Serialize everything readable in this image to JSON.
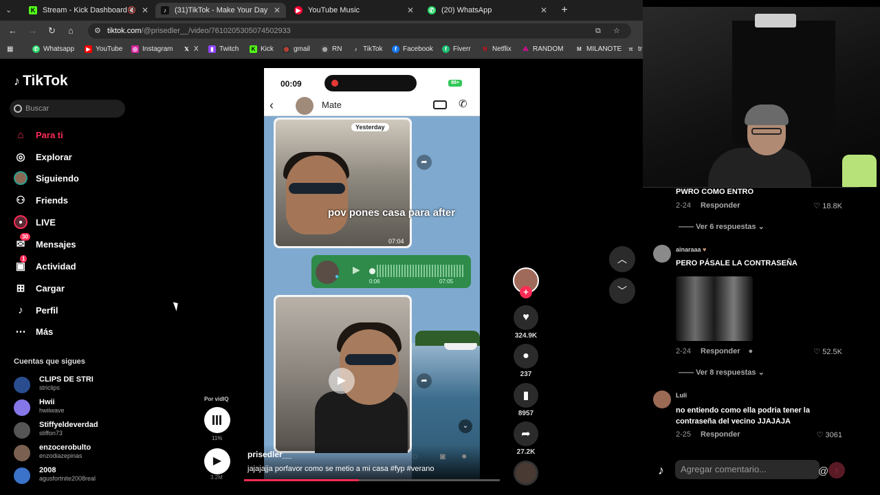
{
  "tabs": [
    {
      "label": "Stream - Kick Dashboard",
      "icon": "kick-icon",
      "color": "#53fc18"
    },
    {
      "label": "(31)TikTok - Make Your Day",
      "icon": "tiktok-icon",
      "color": "#ffffff"
    },
    {
      "label": "YouTube Music",
      "icon": "youtube-music-icon",
      "color": "#ff0033"
    },
    {
      "label": "(20) WhatsApp",
      "icon": "whatsapp-icon",
      "color": "#25d366"
    }
  ],
  "address": {
    "host": "tiktok.com",
    "path": "/@prisedler__/video/7610205305074502933"
  },
  "bookmarks": [
    "Whatsapp",
    "YouTube",
    "Instagram",
    "X",
    "Twitch",
    "Kick",
    "gmail",
    "RN",
    "TikTok",
    "Facebook",
    "Fiverr",
    "Netflix",
    "RANDOM",
    "MILANOTE",
    "tr"
  ],
  "sidebar": {
    "logo": "TikTok",
    "search_placeholder": "Buscar",
    "nav": [
      {
        "label": "Para ti",
        "icon": "home-icon"
      },
      {
        "label": "Explorar",
        "icon": "compass-icon"
      },
      {
        "label": "Siguiendo",
        "icon": "following-avatar-icon"
      },
      {
        "label": "Friends",
        "icon": "friends-icon"
      },
      {
        "label": "LIVE",
        "icon": "live-icon"
      },
      {
        "label": "Mensajes",
        "icon": "messages-icon",
        "badge": "30"
      },
      {
        "label": "Actividad",
        "icon": "activity-icon",
        "badge": "1"
      },
      {
        "label": "Cargar",
        "icon": "upload-icon"
      },
      {
        "label": "Perfil",
        "icon": "profile-icon"
      },
      {
        "label": "Más",
        "icon": "more-icon"
      }
    ],
    "following_title": "Cuentas que sigues",
    "accounts": [
      {
        "name": "CLIPS DE STRI",
        "handle": "striclips"
      },
      {
        "name": "Hwii",
        "handle": "hwiiwave"
      },
      {
        "name": "Stiffyeldeverdad",
        "handle": "stiffon73"
      },
      {
        "name": "enzocerobulto",
        "handle": "enzodiazepinas"
      },
      {
        "name": "2008",
        "handle": "agusfortnite2008real"
      }
    ]
  },
  "video": {
    "phone_time": "00:09",
    "battery": "88+",
    "contact": "Mate",
    "yesterday_label": "Yesterday",
    "overlay_text": "pov pones casa para after",
    "msg1_time": "07:04",
    "voice_duration": "0:06",
    "voice_time": "07:05",
    "author": "prisedler__",
    "caption": "jajajajja porfavor como se metio a mi casa #fyp #verano",
    "progress": 0.45
  },
  "music": {
    "label": "Por vidIQ",
    "percent": "11%",
    "views": "3.2M"
  },
  "actions": {
    "likes": "324.9K",
    "comments": "237",
    "saves": "8957",
    "shares": "27.2K"
  },
  "comments": {
    "items": [
      {
        "text": "PWRO COMO ENTRO",
        "date": "2-24",
        "reply": "Responder",
        "likes": "18.8K",
        "more": "Ver 6 respuestas"
      },
      {
        "user": "ainaraaa",
        "text": "PERO PÁSALE LA CONTRASEÑA",
        "date": "2-24",
        "reply": "Responder",
        "likes": "52.5K",
        "more": "Ver 8 respuestas"
      },
      {
        "user": "Luli",
        "text": "no entiendo como ella podria tener la contraseña del vecino JJAJAJA",
        "date": "2-25",
        "reply": "Responder",
        "likes": "3061"
      }
    ],
    "input_placeholder": "Agregar comentario..."
  }
}
